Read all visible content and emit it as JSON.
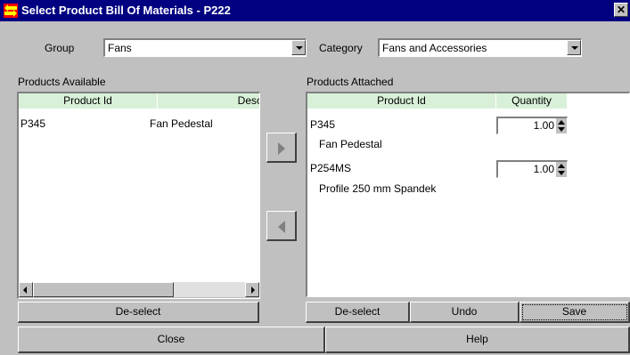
{
  "window": {
    "title": "Select Product Bill Of Materials - P222",
    "close_glyph": "✕",
    "icon": "double-arrow-icon"
  },
  "filters": {
    "group_label": "Group",
    "group_value": "Fans",
    "category_label": "Category",
    "category_value": "Fans and Accessories"
  },
  "available": {
    "label": "Products Available",
    "columns": [
      "Product Id",
      "Desc"
    ],
    "rows": [
      {
        "id": "P345",
        "desc": "Fan Pedestal"
      }
    ],
    "deselect_label": "De-select"
  },
  "attached": {
    "label": "Products Attached",
    "columns": [
      "Product Id",
      "Quantity"
    ],
    "rows": [
      {
        "id": "P345",
        "desc": "Fan Pedestal",
        "qty": "1.00"
      },
      {
        "id": "P254MS",
        "desc": "Profile 250 mm Spandek",
        "qty": "1.00"
      }
    ],
    "deselect_label": "De-select",
    "undo_label": "Undo",
    "save_label": "Save"
  },
  "footer": {
    "close_label": "Close",
    "help_label": "Help"
  },
  "colors": {
    "title_bg": "#000080",
    "header_bg": "#d8f0d8",
    "face": "#c0c0c0"
  }
}
